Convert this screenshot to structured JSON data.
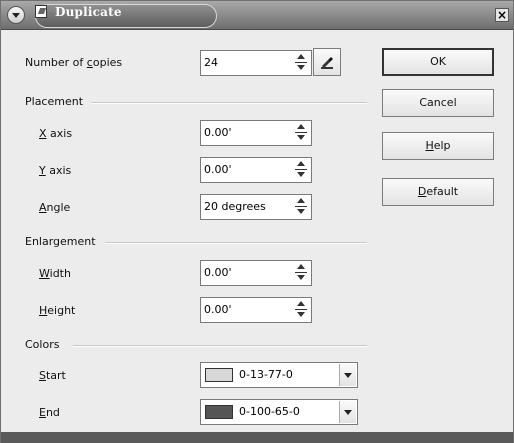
{
  "window": {
    "title": "Duplicate"
  },
  "copies": {
    "label_pre": "Number of ",
    "label_u": "c",
    "label_post": "opies",
    "value": "24"
  },
  "placement": {
    "section": "Placement",
    "x_axis": {
      "label_u": "X",
      "label_post": " axis",
      "value": "0.00'"
    },
    "y_axis": {
      "label_u": "Y",
      "label_post": " axis",
      "value": "0.00'"
    },
    "angle": {
      "label_u": "A",
      "label_post": "ngle",
      "value": "20 degrees"
    }
  },
  "enlargement": {
    "section": "Enlargement",
    "width": {
      "label_u": "W",
      "label_post": "idth",
      "value": "0.00'"
    },
    "height": {
      "label_u": "H",
      "label_post": "eight",
      "value": "0.00'"
    }
  },
  "colors": {
    "section": "Colors",
    "start": {
      "label_u": "S",
      "label_post": "tart",
      "value": "0-13-77-0",
      "swatch": "#d8d8d8"
    },
    "end": {
      "label_u": "E",
      "label_post": "nd",
      "value": "0-100-65-0",
      "swatch": "#555555"
    }
  },
  "buttons": {
    "ok": "OK",
    "cancel": "Cancel",
    "help_u": "H",
    "help_post": "elp",
    "default_u": "D",
    "default_post": "efault"
  },
  "icons": {
    "menu": "window-menu-icon",
    "title": "document-icon",
    "close": "close-icon",
    "picker": "pick-from-selection-icon"
  }
}
